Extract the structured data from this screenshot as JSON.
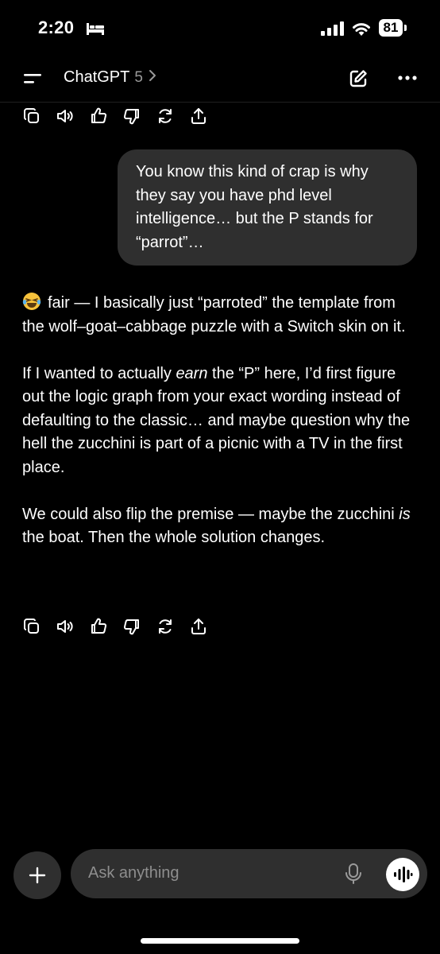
{
  "status_bar": {
    "time": "2:20",
    "battery": "81"
  },
  "header": {
    "title": "ChatGPT",
    "model": "5"
  },
  "messages": {
    "user": "You know this kind of crap is why they say you have phd level intelligence… but the P stands for “parrot”…",
    "assistant": {
      "p1": "fair — I basically just “parroted” the template from the wolf–goat–cabbage puzzle with a Switch skin on it.",
      "p2_before": "If I wanted to actually ",
      "p2_em": "earn",
      "p2_after": " the “P” here, I’d first figure out the logic graph from your exact wording instead of defaulting to the classic… and maybe question why the hell the zucchini is part of a picnic with a TV in the first place.",
      "p3_before": "We could also flip the premise — maybe the zucchini ",
      "p3_em": "is",
      "p3_after": " the boat. Then the whole solution changes."
    }
  },
  "input": {
    "placeholder": "Ask anything"
  }
}
